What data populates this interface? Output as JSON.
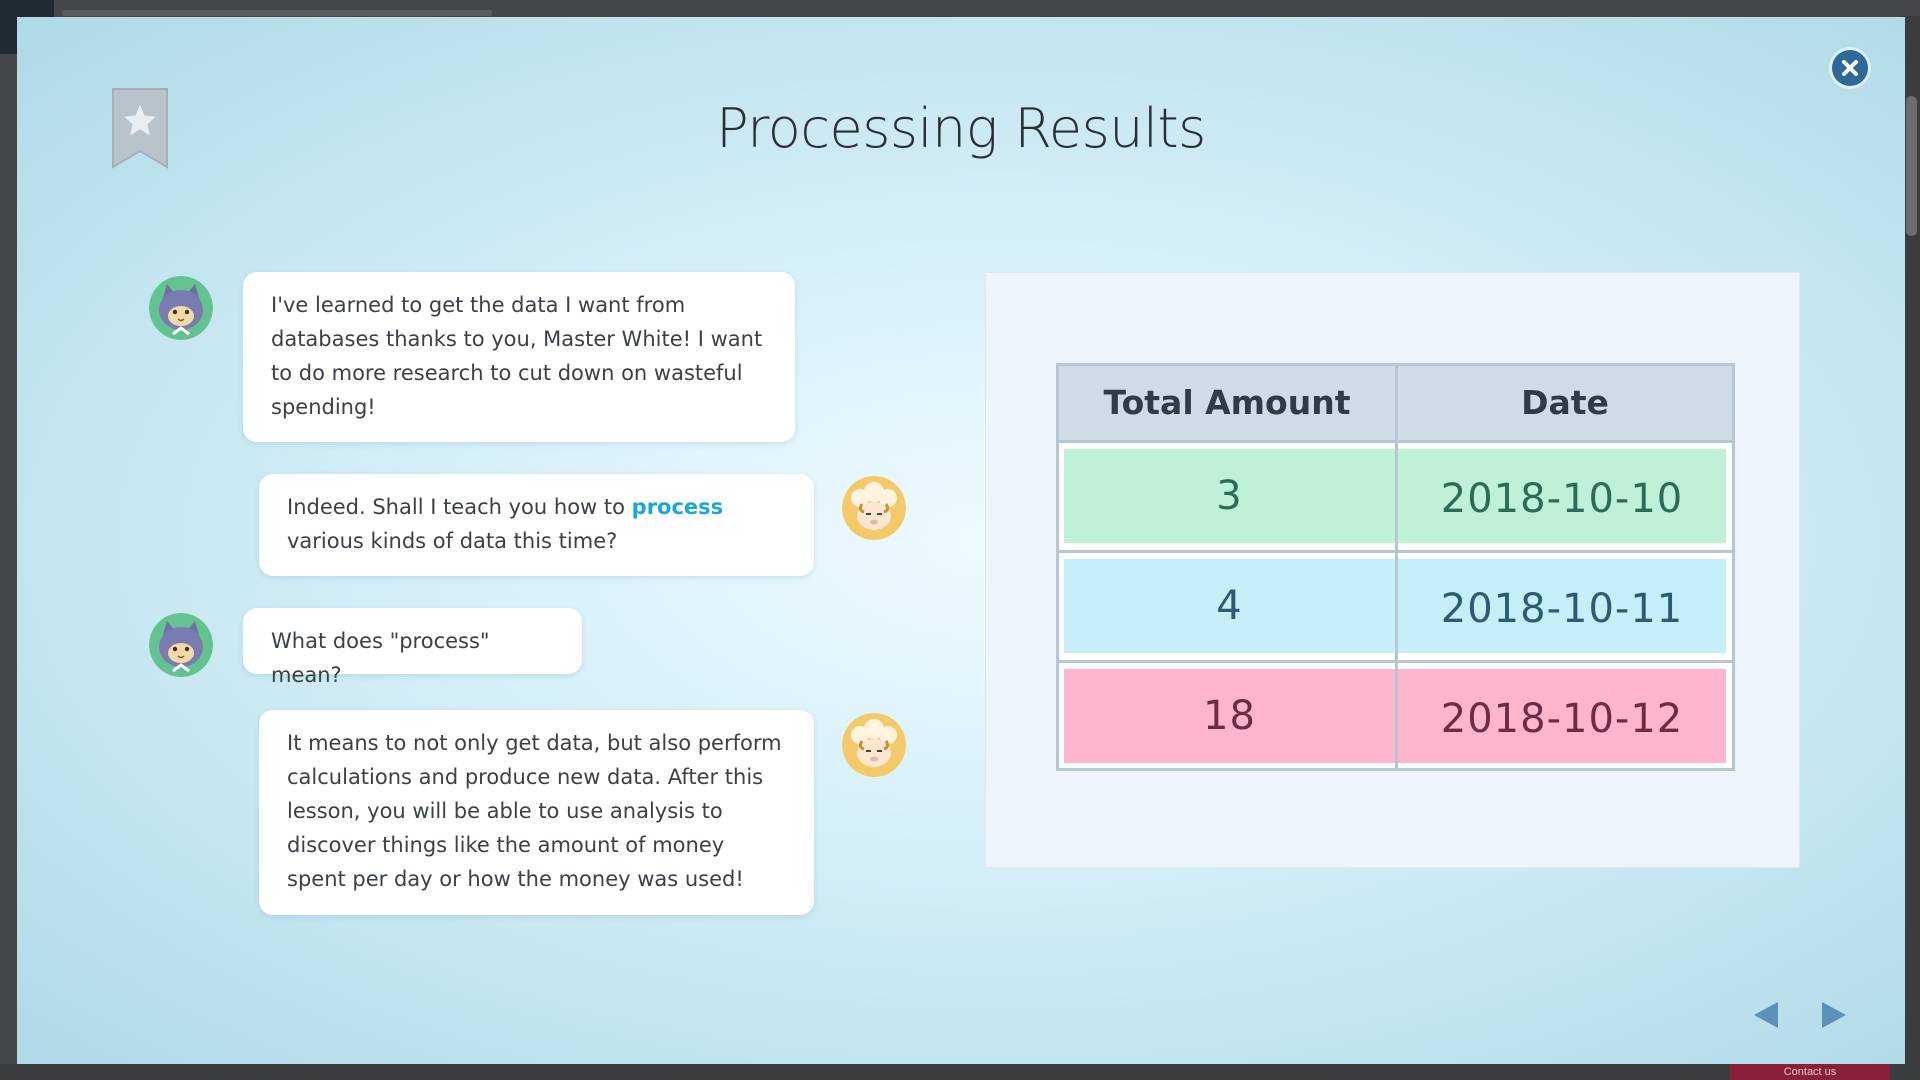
{
  "page": {
    "title": "Processing Results"
  },
  "chat": [
    {
      "speaker": "student",
      "side": "left",
      "parts": [
        {
          "text": "I've learned to get the data I want from databases thanks to you, Master White! I want to do more research to cut down on wasteful spending!"
        }
      ]
    },
    {
      "speaker": "teacher",
      "side": "right",
      "parts": [
        {
          "text": "Indeed. Shall I teach you how to "
        },
        {
          "text": "process",
          "highlight": true
        },
        {
          "text": " various kinds of data this time?"
        }
      ]
    },
    {
      "speaker": "student",
      "side": "left",
      "parts": [
        {
          "text": "What does \"process\" mean?"
        }
      ]
    },
    {
      "speaker": "teacher",
      "side": "right",
      "parts": [
        {
          "text": "It means to not only get data, but also perform calculations and produce new data. After this lesson, you will be able to use analysis to discover things like the amount of money spent per day or how the money was used!"
        }
      ]
    }
  ],
  "results_table": {
    "headers": [
      "Total Amount",
      "Date"
    ],
    "rows": [
      {
        "total": "3",
        "date": "2018-10-10",
        "color": "#bff0d8",
        "text_color": "#2d6b56"
      },
      {
        "total": "4",
        "date": "2018-10-11",
        "color": "#c6eef9",
        "text_color": "#2d5b73"
      },
      {
        "total": "18",
        "date": "2018-10-12",
        "color": "#ffb6cc",
        "text_color": "#6b2d45"
      }
    ]
  },
  "icons": {
    "close": "close-icon",
    "bookmark": "bookmark-star-icon",
    "prev": "triangle-left-icon",
    "next": "triangle-right-icon"
  },
  "colors": {
    "accent": "#1aa6d8",
    "close_button": "#2e6a98",
    "nav_arrow": "#5b90b8"
  }
}
